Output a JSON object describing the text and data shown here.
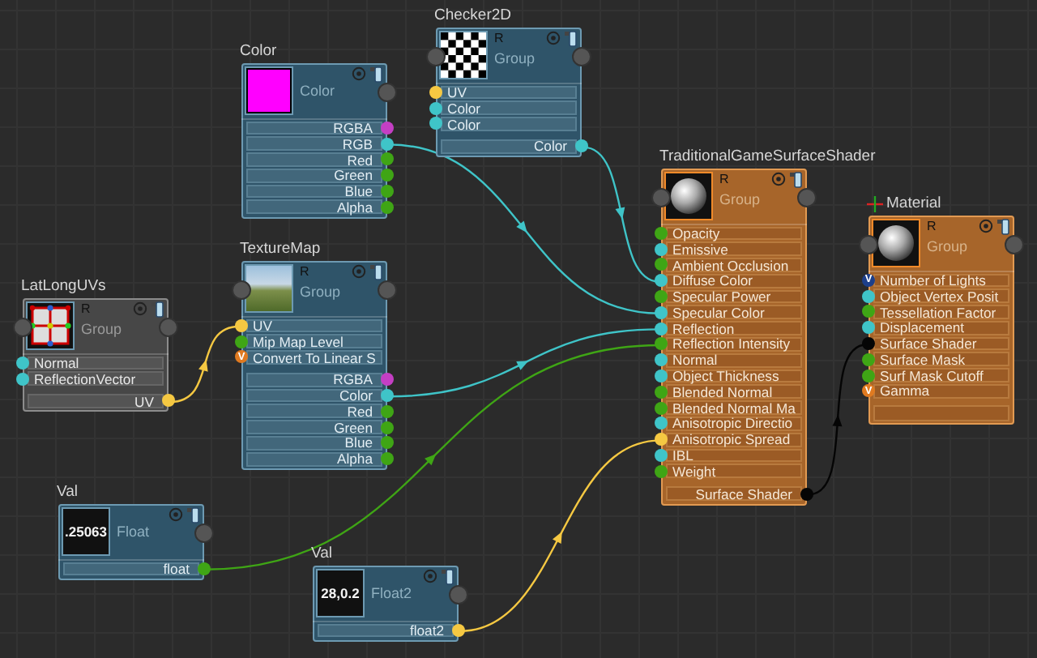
{
  "nodes": [
    {
      "title": "Color",
      "kind": "blue",
      "output": false,
      "header_input": false,
      "preview": {
        "kind": "swatch",
        "color": "#ff00ff"
      },
      "subtitle": "Color",
      "outputs": [
        {
          "label": "RGBA",
          "color": "#c43fc4"
        },
        {
          "label": "RGB",
          "color": "#3fc4c8"
        },
        {
          "label": "Red",
          "color": "#3fa515"
        },
        {
          "label": "Green",
          "color": "#3fa515"
        },
        {
          "label": "Blue",
          "color": "#3fa515"
        },
        {
          "label": "Alpha",
          "color": "#3fa515"
        }
      ]
    },
    {
      "title": "Checker2D",
      "kind": "blue",
      "output": false,
      "header_input": true,
      "preview": {
        "kind": "checker"
      },
      "channel": "R",
      "subtitle": "Group",
      "inputs": [
        {
          "label": "UV",
          "color": "#f5c842"
        },
        {
          "label": "Color",
          "color": "#3fc4c8"
        },
        {
          "label": "Color",
          "color": "#3fc4c8"
        }
      ],
      "outputs": [
        {
          "label": "Color",
          "color": "#3fc4c8"
        }
      ]
    },
    {
      "title": "LatLongUVs",
      "kind": "grey",
      "output": false,
      "header_input": true,
      "preview": {
        "kind": "lattice"
      },
      "channel": "R",
      "subtitle": "Group",
      "inputs": [
        {
          "label": "Normal",
          "color": "#3fc4c8"
        },
        {
          "label": "ReflectionVector",
          "color": "#3fc4c8"
        }
      ],
      "outputs": [
        {
          "label": "UV",
          "color": "#f5c842"
        }
      ]
    },
    {
      "title": "TextureMap",
      "kind": "blue",
      "output": false,
      "header_input": true,
      "preview": {
        "kind": "photo"
      },
      "channel": "R",
      "subtitle": "Group",
      "inputs": [
        {
          "label": "UV",
          "color": "#f5c842"
        },
        {
          "label": "Mip Map Level",
          "color": "#3fa515"
        },
        {
          "label": "Convert To Linear S",
          "color": "#e07a20",
          "badge": "V"
        }
      ],
      "outputs": [
        {
          "label": "RGBA",
          "color": "#c43fc4"
        },
        {
          "label": "Color",
          "color": "#3fc4c8"
        },
        {
          "label": "Red",
          "color": "#3fa515"
        },
        {
          "label": "Green",
          "color": "#3fa515"
        },
        {
          "label": "Blue",
          "color": "#3fa515"
        },
        {
          "label": "Alpha",
          "color": "#3fa515"
        }
      ]
    },
    {
      "title": "Val",
      "kind": "blue",
      "output": false,
      "header_input": false,
      "preview": {
        "kind": "value",
        "text": ".25063"
      },
      "subtitle": "Float",
      "outputs": [
        {
          "label": "float",
          "color": "#3fa515"
        }
      ]
    },
    {
      "title": "Val",
      "kind": "blue",
      "output": false,
      "header_input": false,
      "preview": {
        "kind": "value",
        "text": "28,0.2"
      },
      "subtitle": "Float2",
      "outputs": [
        {
          "label": "float2",
          "color": "#f5c842"
        }
      ]
    },
    {
      "title": "TraditionalGameSurfaceShader",
      "kind": "orange",
      "output": false,
      "header_input": true,
      "preview": {
        "kind": "sphere"
      },
      "channel": "R",
      "subtitle": "Group",
      "inputs": [
        {
          "label": "Opacity",
          "color": "#3fa515"
        },
        {
          "label": "Emissive",
          "color": "#3fc4c8"
        },
        {
          "label": "Ambient Occlusion",
          "color": "#3fa515"
        },
        {
          "label": "Diffuse Color",
          "color": "#3fc4c8"
        },
        {
          "label": "Specular Power",
          "color": "#3fa515"
        },
        {
          "label": "Specular Color",
          "color": "#3fc4c8"
        },
        {
          "label": "Reflection",
          "color": "#3fc4c8"
        },
        {
          "label": "Reflection Intensity",
          "color": "#3fa515"
        },
        {
          "label": "Normal",
          "color": "#3fc4c8"
        },
        {
          "label": "Object Thickness",
          "color": "#3fc4c8"
        },
        {
          "label": "Blended Normal",
          "color": "#3fa515"
        },
        {
          "label": "Blended Normal Ma",
          "color": "#3fa515"
        },
        {
          "label": "Anisotropic Directio",
          "color": "#3fc4c8"
        },
        {
          "label": "Anisotropic Spread",
          "color": "#f5c842"
        },
        {
          "label": "IBL",
          "color": "#3fc4c8"
        },
        {
          "label": "Weight",
          "color": "#3fa515"
        }
      ],
      "outputs": [
        {
          "label": "Surface Shader",
          "color": "#050505"
        }
      ]
    },
    {
      "title": "Material",
      "kind": "orange",
      "output": true,
      "header_input": true,
      "preview": {
        "kind": "sphere"
      },
      "channel": "R",
      "subtitle": "Group",
      "inputs": [
        {
          "label": "Number of Lights",
          "color": "#1d3f8a",
          "badge": "V"
        },
        {
          "label": "Object Vertex Posit",
          "color": "#3fc4c8"
        },
        {
          "label": "Tessellation Factor",
          "color": "#3fa515"
        },
        {
          "label": "Displacement",
          "color": "#3fc4c8"
        },
        {
          "label": "Surface Shader",
          "color": "#050505"
        },
        {
          "label": "Surface Mask",
          "color": "#3fa515"
        },
        {
          "label": "Surf Mask Cutoff",
          "color": "#3fa515"
        },
        {
          "label": "Gamma",
          "color": "#e07a20",
          "badge": "V"
        }
      ]
    }
  ]
}
